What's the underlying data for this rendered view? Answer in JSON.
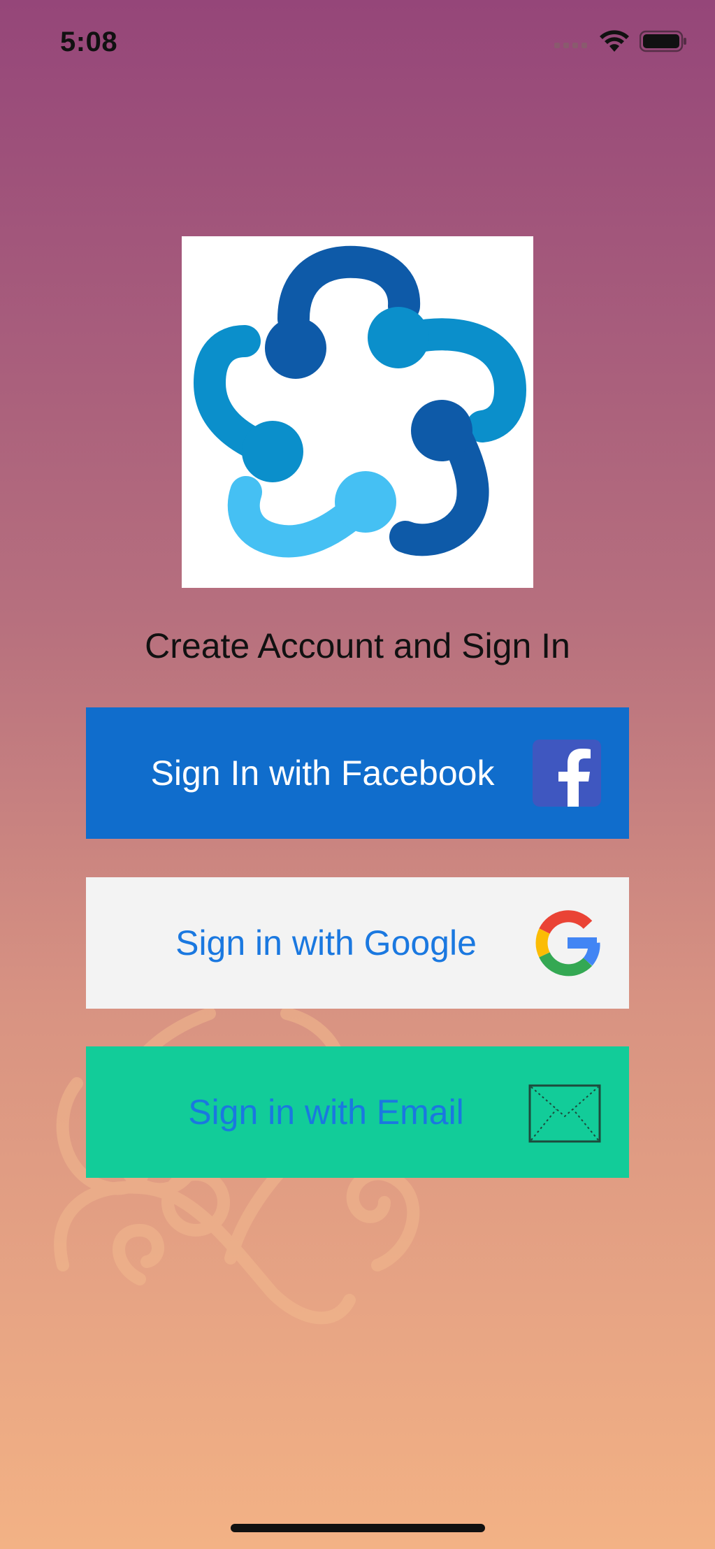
{
  "status_bar": {
    "time": "5:08",
    "icons": [
      "signal-icon",
      "wifi-icon",
      "battery-icon"
    ]
  },
  "logo": {
    "icon": "app-logo"
  },
  "title": "Create Account and Sign In",
  "buttons": {
    "facebook": {
      "label": "Sign In with Facebook",
      "icon": "facebook-icon"
    },
    "google": {
      "label": "Sign in with Google",
      "icon": "google-icon"
    },
    "email": {
      "label": "Sign in with Email",
      "icon": "envelope-icon"
    }
  },
  "colors": {
    "facebook_bg": "#106dcc",
    "google_bg": "#f3f3f3",
    "email_bg": "#12cc99",
    "label_blue": "#1a78e0"
  }
}
